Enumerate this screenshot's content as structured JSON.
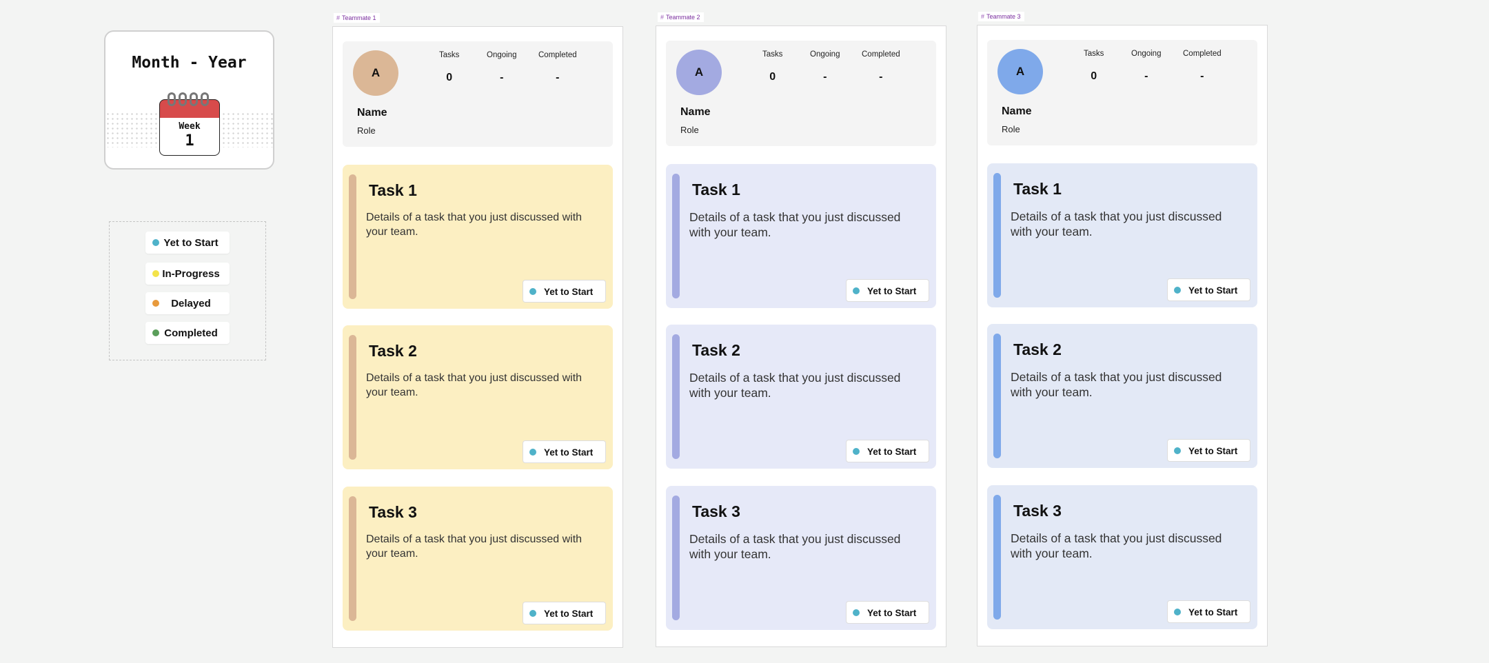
{
  "calendar": {
    "title": "Month - Year",
    "week_label": "Week",
    "week_number": "1"
  },
  "legend": {
    "items": [
      {
        "label": "Yet to Start",
        "color": "#4fb2c9"
      },
      {
        "label": "In-Progress",
        "color": "#f3e34a"
      },
      {
        "label": "Delayed",
        "color": "#e89a3c"
      },
      {
        "label": "Completed",
        "color": "#5a9e5a"
      }
    ]
  },
  "teammates": [
    {
      "frame_label": "Teammate 1",
      "avatar_letter": "A",
      "avatar_color": "#dbb796",
      "name": "Name",
      "role": "Role",
      "stats": {
        "tasks_label": "Tasks",
        "tasks": "0",
        "ongoing_label": "Ongoing",
        "ongoing": "-",
        "completed_label": "Completed",
        "completed": "-"
      },
      "card_color": "#fcefc2",
      "bar_color": "#dbb796",
      "tasks": [
        {
          "title": "Task 1",
          "desc": "Details of a task that you just discussed with your team.",
          "status": "Yet to Start"
        },
        {
          "title": "Task 2",
          "desc": "Details of a task that you just discussed with your team.",
          "status": "Yet to Start"
        },
        {
          "title": "Task 3",
          "desc": "Details of a task that you just discussed with your team.",
          "status": "Yet to Start"
        }
      ]
    },
    {
      "frame_label": "Teammate 2",
      "avatar_letter": "A",
      "avatar_color": "#a3aae1",
      "name": "Name",
      "role": "Role",
      "stats": {
        "tasks_label": "Tasks",
        "tasks": "0",
        "ongoing_label": "Ongoing",
        "ongoing": "-",
        "completed_label": "Completed",
        "completed": "-"
      },
      "card_color": "#e6e9f8",
      "bar_color": "#a3aae1",
      "tasks": [
        {
          "title": "Task 1",
          "desc": "Details of a task that you just discussed with your team.",
          "status": "Yet to Start"
        },
        {
          "title": "Task 2",
          "desc": "Details of a task that you just discussed with your team.",
          "status": "Yet to Start"
        },
        {
          "title": "Task 3",
          "desc": "Details of a task that you just discussed with your team.",
          "status": "Yet to Start"
        }
      ]
    },
    {
      "frame_label": "Teammate 3",
      "avatar_letter": "A",
      "avatar_color": "#7fa9ea",
      "name": "Name",
      "role": "Role",
      "stats": {
        "tasks_label": "Tasks",
        "tasks": "0",
        "ongoing_label": "Ongoing",
        "ongoing": "-",
        "completed_label": "Completed",
        "completed": "-"
      },
      "card_color": "#e3e9f6",
      "bar_color": "#7fa9ea",
      "tasks": [
        {
          "title": "Task 1",
          "desc": "Details of a task that you just discussed with your team.",
          "status": "Yet to Start"
        },
        {
          "title": "Task 2",
          "desc": "Details of a task that you just discussed with your team.",
          "status": "Yet to Start"
        },
        {
          "title": "Task 3",
          "desc": "Details of a task that you just discussed with your team.",
          "status": "Yet to Start"
        }
      ]
    }
  ],
  "status_color": "#4fb2c9"
}
